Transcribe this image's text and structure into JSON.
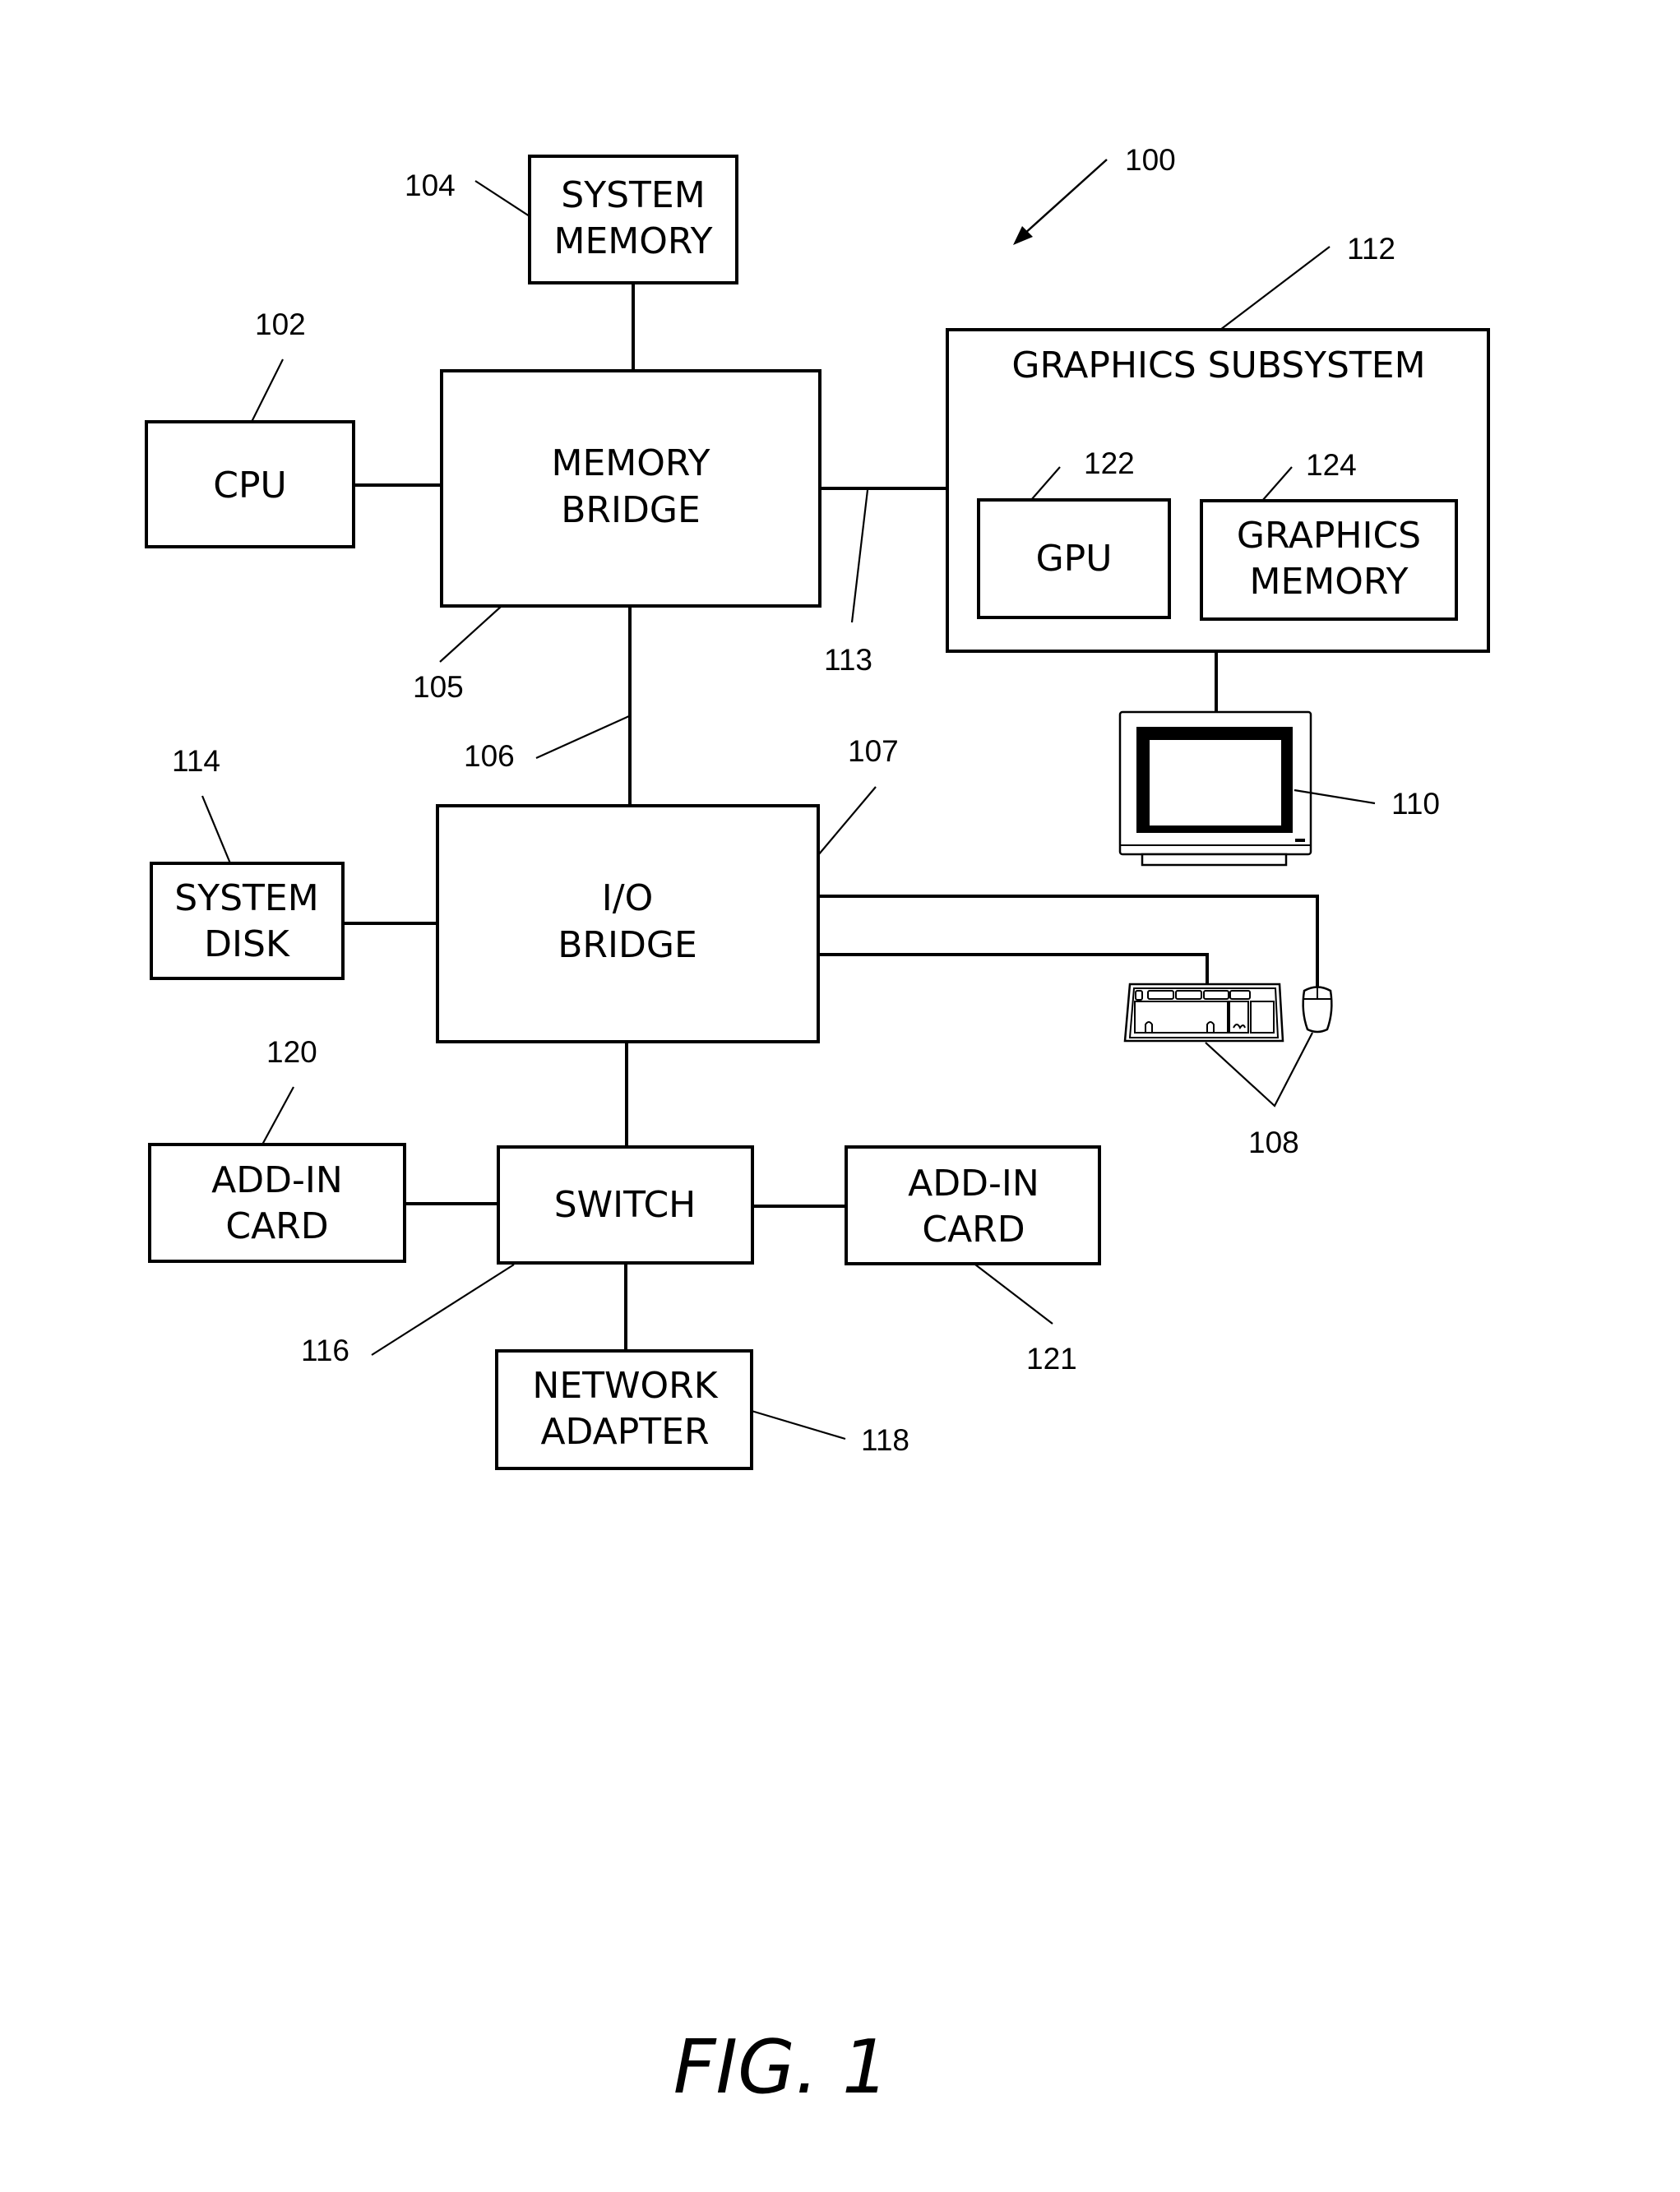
{
  "figure": {
    "caption": "FIG. 1",
    "system_ref": "100"
  },
  "components": {
    "system_memory": {
      "lines": [
        "SYSTEM",
        "MEMORY"
      ],
      "ref": "104"
    },
    "cpu": {
      "lines": [
        "CPU"
      ],
      "ref": "102"
    },
    "memory_bridge": {
      "lines": [
        "MEMORY",
        "BRIDGE"
      ],
      "ref": "105"
    },
    "graphics_subsystem": {
      "lines": [
        "GRAPHICS SUBSYSTEM"
      ],
      "ref": "112"
    },
    "gpu": {
      "lines": [
        "GPU"
      ],
      "ref": "122"
    },
    "graphics_memory": {
      "lines": [
        "GRAPHICS",
        "MEMORY"
      ],
      "ref": "124"
    },
    "display": {
      "ref": "110"
    },
    "system_disk": {
      "lines": [
        "SYSTEM",
        "DISK"
      ],
      "ref": "114"
    },
    "io_bridge": {
      "lines": [
        "I/O",
        "BRIDGE"
      ],
      "ref": "107"
    },
    "input_devices": {
      "ref": "108"
    },
    "add_in_card_left": {
      "lines": [
        "ADD-IN",
        "CARD"
      ],
      "ref": "120"
    },
    "switch": {
      "lines": [
        "SWITCH"
      ],
      "ref": "116"
    },
    "add_in_card_right": {
      "lines": [
        "ADD-IN",
        "CARD"
      ],
      "ref": "121"
    },
    "network_adapter": {
      "lines": [
        "NETWORK",
        "ADAPTER"
      ],
      "ref": "118"
    }
  },
  "buses": {
    "communication_path_memory_io": {
      "ref": "106"
    },
    "communication_path_graphics": {
      "ref": "113"
    }
  }
}
